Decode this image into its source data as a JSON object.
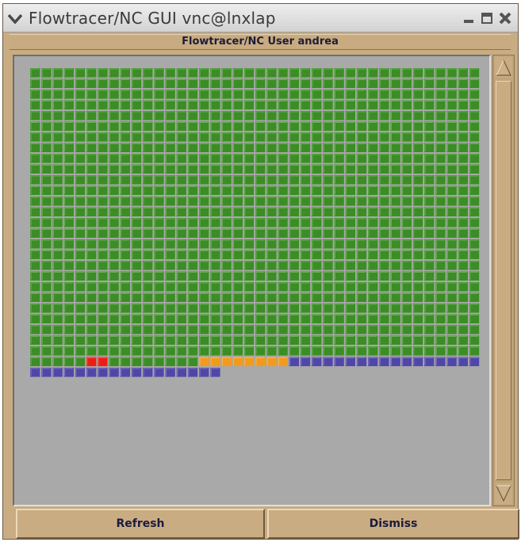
{
  "window": {
    "title": "Flowtracer/NC GUI vnc@lnxlap"
  },
  "header": {
    "label": "Flowtracer/NC User andrea"
  },
  "buttons": {
    "refresh": "Refresh",
    "dismiss": "Dismiss"
  },
  "grid": {
    "columns": 40,
    "row_count": 29,
    "colors": {
      "green": "#3a8e23",
      "red": "#ee1d14",
      "orange": "#f29a1c",
      "purple": "#4f47a8"
    },
    "rows": [
      {
        "count": 40,
        "state": "green"
      },
      {
        "count": 40,
        "state": "green"
      },
      {
        "count": 40,
        "state": "green"
      },
      {
        "count": 40,
        "state": "green"
      },
      {
        "count": 40,
        "state": "green"
      },
      {
        "count": 40,
        "state": "green"
      },
      {
        "count": 40,
        "state": "green"
      },
      {
        "count": 40,
        "state": "green"
      },
      {
        "count": 40,
        "state": "green"
      },
      {
        "count": 40,
        "state": "green"
      },
      {
        "count": 40,
        "state": "green"
      },
      {
        "count": 40,
        "state": "green"
      },
      {
        "count": 40,
        "state": "green"
      },
      {
        "count": 40,
        "state": "green"
      },
      {
        "count": 40,
        "state": "green"
      },
      {
        "count": 40,
        "state": "green"
      },
      {
        "count": 40,
        "state": "green"
      },
      {
        "count": 40,
        "state": "green"
      },
      {
        "count": 40,
        "state": "green"
      },
      {
        "count": 40,
        "state": "green"
      },
      {
        "count": 40,
        "state": "green"
      },
      {
        "count": 40,
        "state": "green"
      },
      {
        "count": 40,
        "state": "green"
      },
      {
        "count": 40,
        "state": "green"
      },
      {
        "count": 40,
        "state": "green"
      },
      {
        "count": 40,
        "state": "green"
      },
      {
        "count": 40,
        "state": "green"
      },
      {
        "segments": [
          {
            "count": 5,
            "state": "green"
          },
          {
            "count": 2,
            "state": "red"
          },
          {
            "count": 8,
            "state": "green"
          },
          {
            "count": 8,
            "state": "orange"
          },
          {
            "count": 17,
            "state": "purple"
          }
        ]
      },
      {
        "count": 17,
        "state": "purple"
      }
    ]
  }
}
